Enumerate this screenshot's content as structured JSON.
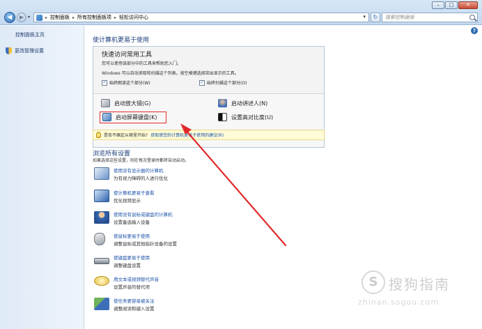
{
  "window": {
    "minimize_label": "–",
    "maximize_label": "□",
    "close_label": "✕"
  },
  "address": {
    "breadcrumbs": [
      "控制面板",
      "所有控制面板项",
      "轻松访问中心"
    ],
    "search_placeholder": "搜索控制面板"
  },
  "sidebar": {
    "items": [
      {
        "label": "控制面板主页"
      },
      {
        "label": "更改管理设置"
      }
    ]
  },
  "main": {
    "title": "使计算机更易于使用",
    "quick": {
      "title": "快速访问常用工具",
      "desc": "您可以使用该部分中的工具来帮助您入门。",
      "desc2": "Windows 可以自动读取和扫描这个列表。按空格键选择突出显示的工具。",
      "check1": "始终朗读这个部分(W)",
      "check2": "始终扫描这个部分(O)",
      "tools": [
        {
          "label": "启动放大镜(G)"
        },
        {
          "label": "启动讲述人(N)"
        },
        {
          "label": "启动屏幕键盘(K)"
        },
        {
          "label": "设置高对比度(U)"
        }
      ]
    },
    "tip": {
      "static": "是否不确定从哪里开始?",
      "link": "获取使您的计算机更易于使用的建议(R)"
    },
    "browse": {
      "title": "浏览所有设置",
      "desc": "如果选择这些设置，则在每次登录时都将自动启动。",
      "items": [
        {
          "link": "使用没有显示器的计算机",
          "sub": "为有视力障碍的人进行优化"
        },
        {
          "link": "使计算机更易于查看",
          "sub": "优化视频显示"
        },
        {
          "link": "使用没有鼠标或键盘的计算机",
          "sub": "设置备选输入设备"
        },
        {
          "link": "使鼠标更易于使用",
          "sub": "调整鼠标或其他指针设备的设置"
        },
        {
          "link": "使键盘更易于使用",
          "sub": "调整键盘设置"
        },
        {
          "link": "用文本或视频替代声音",
          "sub": "设置声音的替代项"
        },
        {
          "link": "使任务更容易被关注",
          "sub": "调整阅读和键入设置"
        }
      ]
    }
  },
  "watermark": {
    "logo": "S",
    "text": "搜狗指南",
    "url": "zhinan.sogou.com"
  },
  "colors": {
    "link": "#1a52a8",
    "annotation": "#e02a2a"
  }
}
